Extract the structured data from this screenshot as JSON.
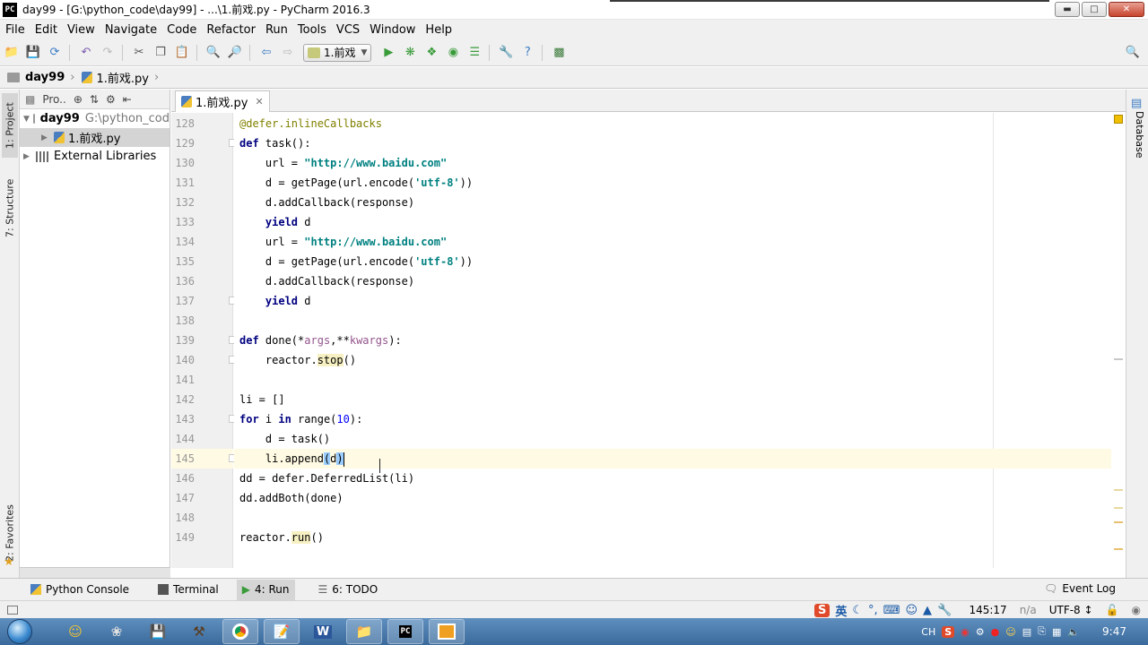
{
  "window": {
    "title": "day99 - [G:\\python_code\\day99] - ...\\1.前戏.py - PyCharm 2016.3",
    "app_icon": "PC"
  },
  "menu": [
    "File",
    "Edit",
    "View",
    "Navigate",
    "Code",
    "Refactor",
    "Run",
    "Tools",
    "VCS",
    "Window",
    "Help"
  ],
  "toolbar": {
    "run_config": "1.前戏"
  },
  "breadcrumb": {
    "project": "day99",
    "file": "1.前戏.py"
  },
  "left_strip": {
    "project_tab": "1: Project",
    "structure_tab": "7: Structure",
    "favorites_tab": "2: Favorites"
  },
  "project_panel": {
    "header_label": "Pro..",
    "root_name": "day99",
    "root_path": "G:\\python_cod",
    "file": "1.前戏.py",
    "external": "External Libraries"
  },
  "editor": {
    "tab_label": "1.前戏.py",
    "current_line": "145",
    "lines": [
      {
        "n": "128",
        "text": "@defer.inlineCallbacks"
      },
      {
        "n": "129",
        "text": "def task():"
      },
      {
        "n": "130",
        "text": "    url = \"http://www.baidu.com\""
      },
      {
        "n": "131",
        "text": "    d = getPage(url.encode('utf-8'))"
      },
      {
        "n": "132",
        "text": "    d.addCallback(response)"
      },
      {
        "n": "133",
        "text": "    yield d"
      },
      {
        "n": "134",
        "text": "    url = \"http://www.baidu.com\""
      },
      {
        "n": "135",
        "text": "    d = getPage(url.encode('utf-8'))"
      },
      {
        "n": "136",
        "text": "    d.addCallback(response)"
      },
      {
        "n": "137",
        "text": "    yield d"
      },
      {
        "n": "138",
        "text": ""
      },
      {
        "n": "139",
        "text": "def done(*args,**kwargs):"
      },
      {
        "n": "140",
        "text": "    reactor.stop()"
      },
      {
        "n": "141",
        "text": ""
      },
      {
        "n": "142",
        "text": "li = []"
      },
      {
        "n": "143",
        "text": "for i in range(10):"
      },
      {
        "n": "144",
        "text": "    d = task()"
      },
      {
        "n": "145",
        "text": "    li.append(d)"
      },
      {
        "n": "146",
        "text": "dd = defer.DeferredList(li)"
      },
      {
        "n": "147",
        "text": "dd.addBoth(done)"
      },
      {
        "n": "148",
        "text": ""
      },
      {
        "n": "149",
        "text": "reactor.run()"
      }
    ]
  },
  "right_strip": {
    "database_tab": "Database"
  },
  "tool_windows": {
    "python_console": "Python Console",
    "terminal": "Terminal",
    "run": "4: Run",
    "todo": "6: TODO",
    "event_log": "Event Log"
  },
  "status": {
    "position": "145:17",
    "line_sep": "n/a",
    "encoding": "UTF-8",
    "ime_lang": "英"
  },
  "taskbar": {
    "lang": "CH",
    "time": "9:47"
  }
}
